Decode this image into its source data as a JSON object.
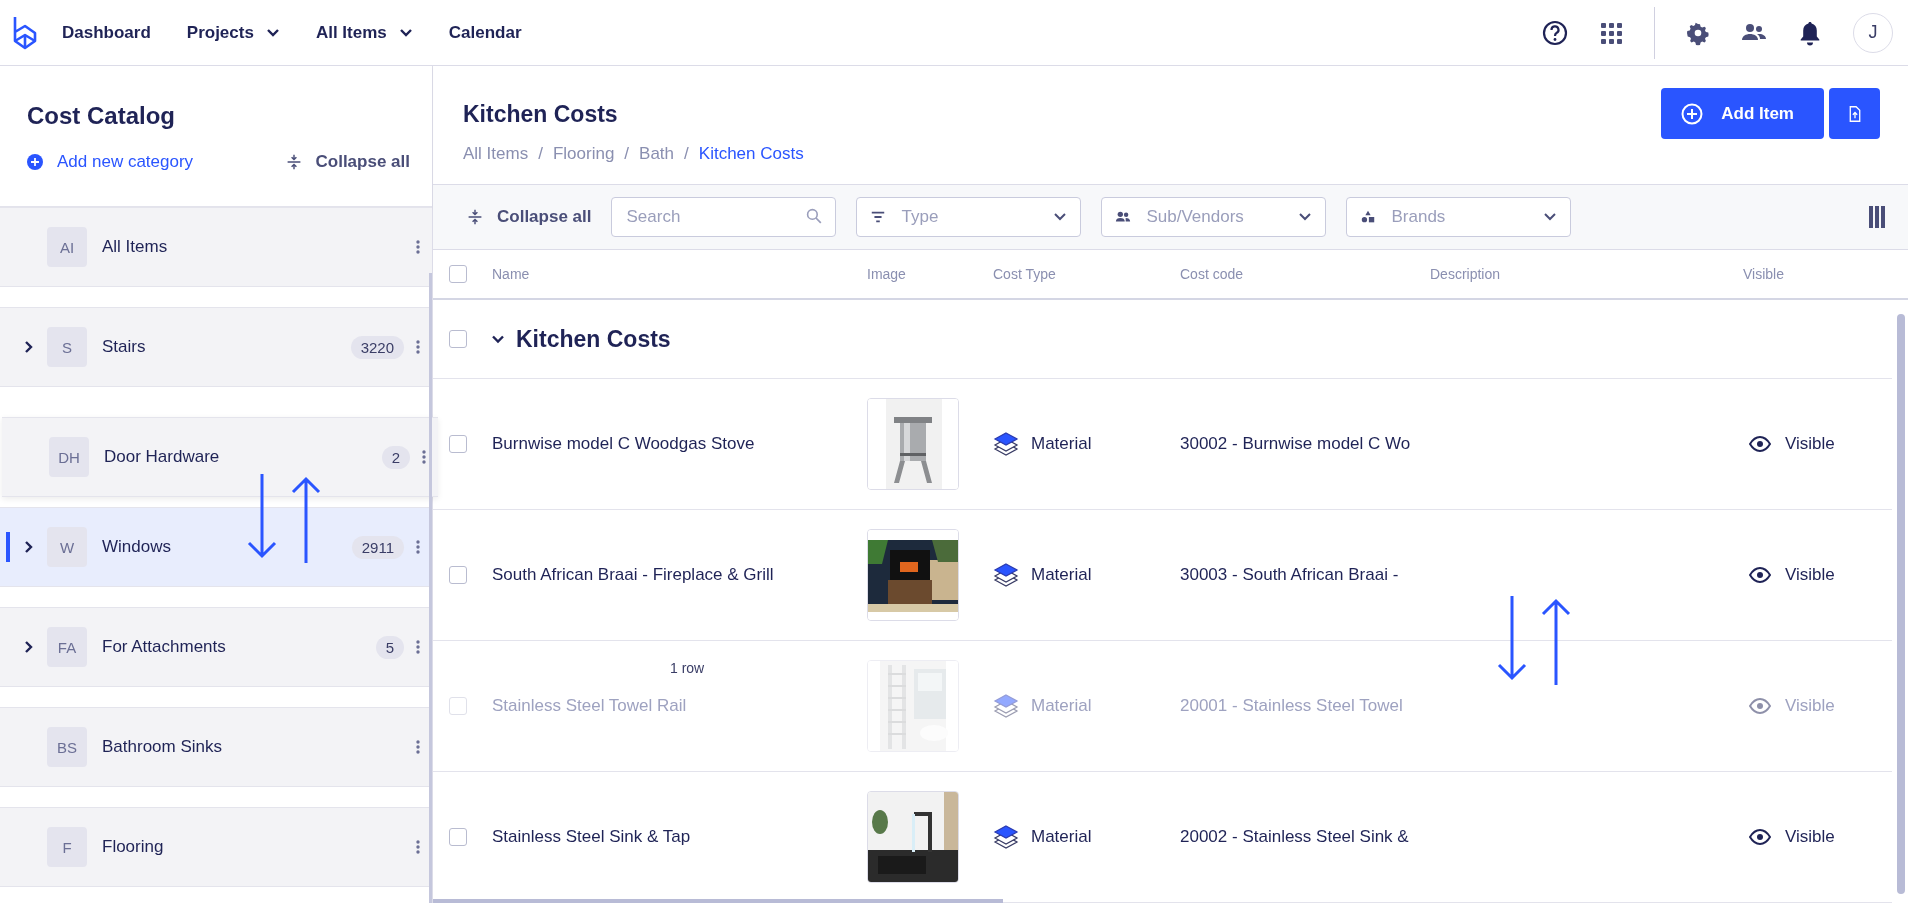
{
  "nav": {
    "items": [
      {
        "label": "Dashboard",
        "dropdown": false
      },
      {
        "label": "Projects",
        "dropdown": true
      },
      {
        "label": "All Items",
        "dropdown": true
      },
      {
        "label": "Calendar",
        "dropdown": false
      }
    ],
    "avatar": "J"
  },
  "sidebar": {
    "title": "Cost Catalog",
    "add_label": "Add new category",
    "collapse_label": "Collapse all",
    "items": [
      {
        "initials": "AI",
        "label": "All Items",
        "expandable": false,
        "selected": false,
        "dragging": false
      },
      {
        "initials": "S",
        "label": "Stairs",
        "count": "3220",
        "expandable": true,
        "selected": false,
        "dragging": false
      },
      {
        "initials": "DH",
        "label": "Door Hardware",
        "count": "2",
        "expandable": false,
        "selected": false,
        "dragging": true
      },
      {
        "initials": "W",
        "label": "Windows",
        "count": "2911",
        "expandable": true,
        "selected": true,
        "dragging": false
      },
      {
        "initials": "FA",
        "label": "For Attachments",
        "count": "5",
        "expandable": true,
        "selected": false,
        "dragging": false
      },
      {
        "initials": "BS",
        "label": "Bathroom Sinks",
        "expandable": false,
        "selected": false,
        "dragging": false
      },
      {
        "initials": "F",
        "label": "Flooring",
        "expandable": false,
        "selected": false,
        "dragging": false
      }
    ]
  },
  "main": {
    "title": "Kitchen Costs",
    "breadcrumb": [
      {
        "label": "All Items",
        "current": false
      },
      {
        "separator": "/",
        "label": "Flooring",
        "current": false
      },
      {
        "separator": "/",
        "label": "Bath",
        "current": false
      },
      {
        "separator": "/",
        "label": "Kitchen Costs",
        "current": true
      }
    ],
    "add_button": "Add Item",
    "toolbar": {
      "collapse_label": "Collapse all",
      "search": {
        "placeholder": "Search"
      },
      "filters": [
        {
          "kind": "type",
          "placeholder": "Type"
        },
        {
          "kind": "vendors",
          "placeholder": "Sub/Vendors"
        },
        {
          "kind": "brands",
          "placeholder": "Brands"
        }
      ]
    },
    "table": {
      "all_checked": false,
      "columns": [
        "Name",
        "Image",
        "Cost Type",
        "Cost code",
        "Description",
        "Visible"
      ],
      "group": {
        "label": "Kitchen Costs",
        "expanded": true,
        "checked": false
      },
      "rows": [
        {
          "name": "Burnwise model C Woodgas Stove",
          "cost_type": "Material",
          "cost_code": "30002 - Burnwise model C Wo",
          "visible": "Visible",
          "checked": false,
          "dragging": false
        },
        {
          "name": "South African Braai - Fireplace & Grill",
          "cost_type": "Material",
          "cost_code": "30003 - South African Braai -",
          "visible": "Visible",
          "checked": false,
          "dragging": false
        },
        {
          "name": "Stainless Steel Towel Rail",
          "cost_type": "Material",
          "cost_code": "20001 - Stainless Steel Towel",
          "visible": "Visible",
          "checked": false,
          "dragging": true,
          "drag_label": "1 row"
        },
        {
          "name": "Stainless Steel Sink & Tap",
          "cost_type": "Material",
          "cost_code": "20002 - Stainless Steel Sink &",
          "visible": "Visible",
          "checked": false,
          "dragging": false
        }
      ]
    }
  }
}
